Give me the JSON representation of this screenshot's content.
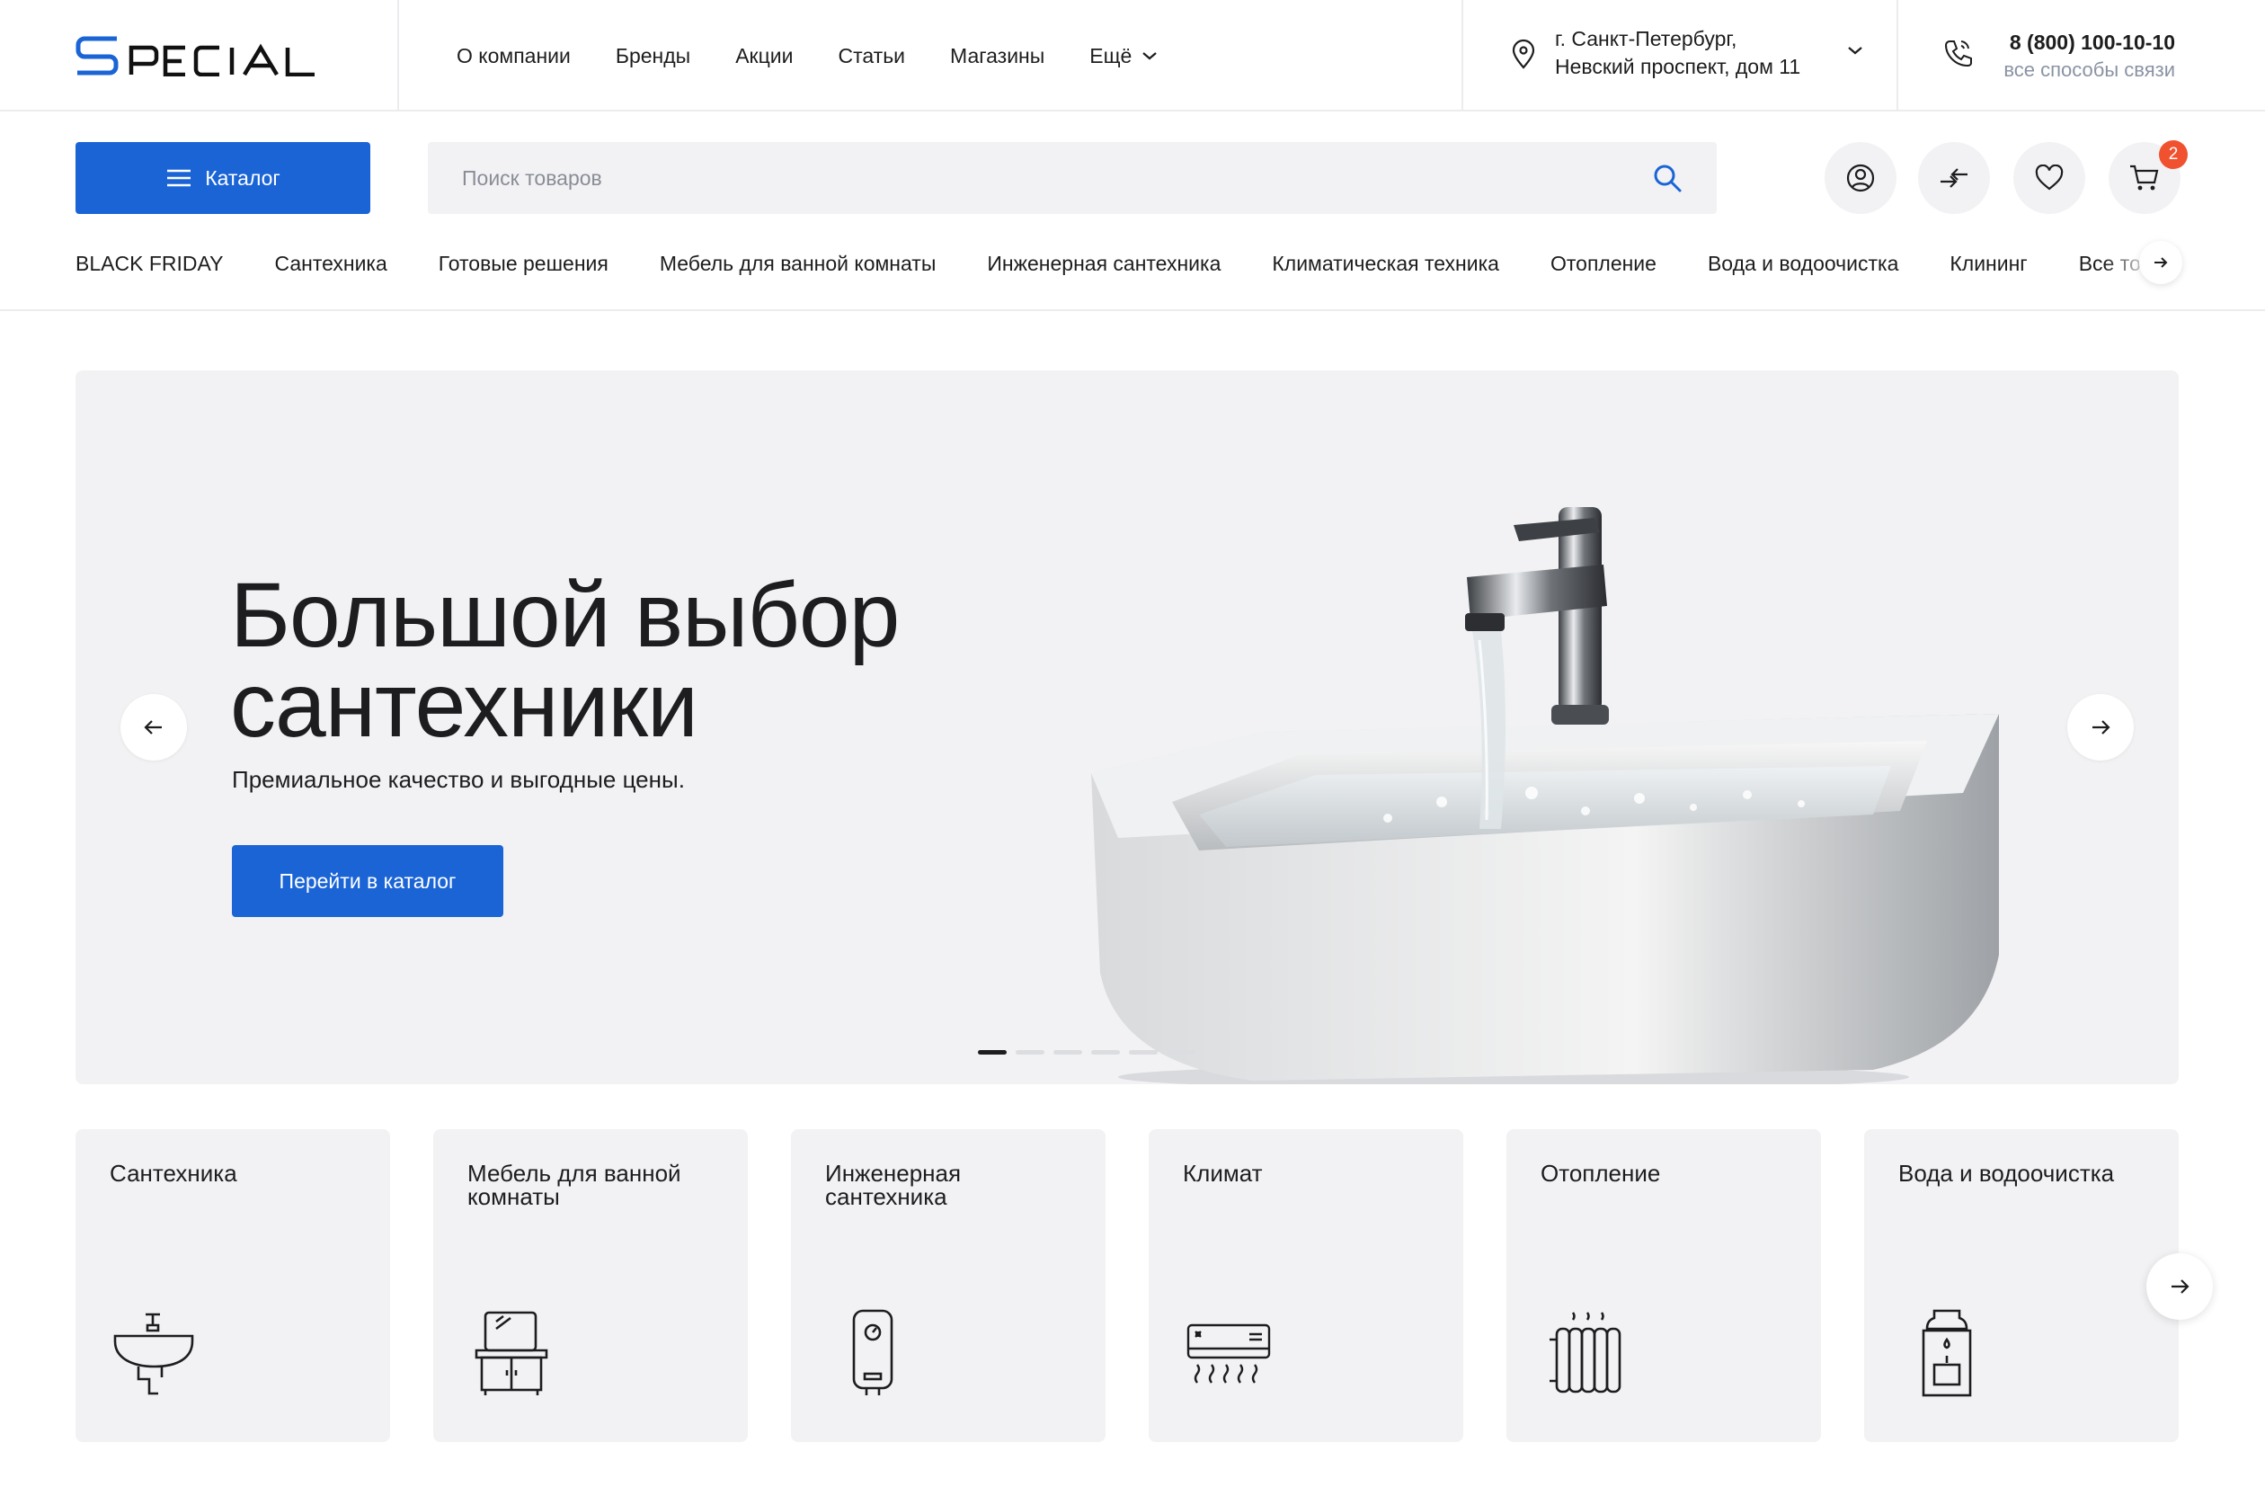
{
  "brand": {
    "logo_text": "SPECIAL",
    "accent_color": "#1a64d6"
  },
  "topnav": {
    "links": [
      "О компании",
      "Бренды",
      "Акции",
      "Статьи",
      "Магазины"
    ],
    "more_label": "Ещё"
  },
  "location": {
    "line1": "г. Санкт-Петербург,",
    "line2": "Невский проспект, дом 11"
  },
  "contact": {
    "phone": "8 (800) 100-10-10",
    "all_ways": "все способы связи"
  },
  "search": {
    "catalog_label": "Каталог",
    "placeholder": "Поиск товаров",
    "value": ""
  },
  "header_icons": {
    "cart_count": "2",
    "badge_color": "#f0512f",
    "icons": [
      "user-icon",
      "compare-icon",
      "heart-icon",
      "cart-icon"
    ]
  },
  "categories": [
    "BLACK FRIDAY",
    "Сантехника",
    "Готовые решения",
    "Мебель для ванной комнаты",
    "Инженерная сантехника",
    "Климатическая техника",
    "Отопление",
    "Вода и водоочистка",
    "Клининг",
    "Все товары"
  ],
  "hero": {
    "title_line1": "Большой выбор",
    "title_line2": "сантехники",
    "subtitle": "Премиальное качество и выгодные цены.",
    "cta": "Перейти в каталог",
    "slide_count": 6,
    "active_slide": 1
  },
  "cards": [
    {
      "title": "Сантехника",
      "icon": "washbasin-icon"
    },
    {
      "title": "Мебель для ванной комнаты",
      "icon": "bathroom-cabinet-icon"
    },
    {
      "title": "Инженерная сантехника",
      "icon": "water-heater-icon"
    },
    {
      "title": "Климат",
      "icon": "air-conditioner-icon"
    },
    {
      "title": "Отопление",
      "icon": "radiator-icon"
    },
    {
      "title": "Вода и водоочистка",
      "icon": "water-cooler-icon"
    }
  ]
}
